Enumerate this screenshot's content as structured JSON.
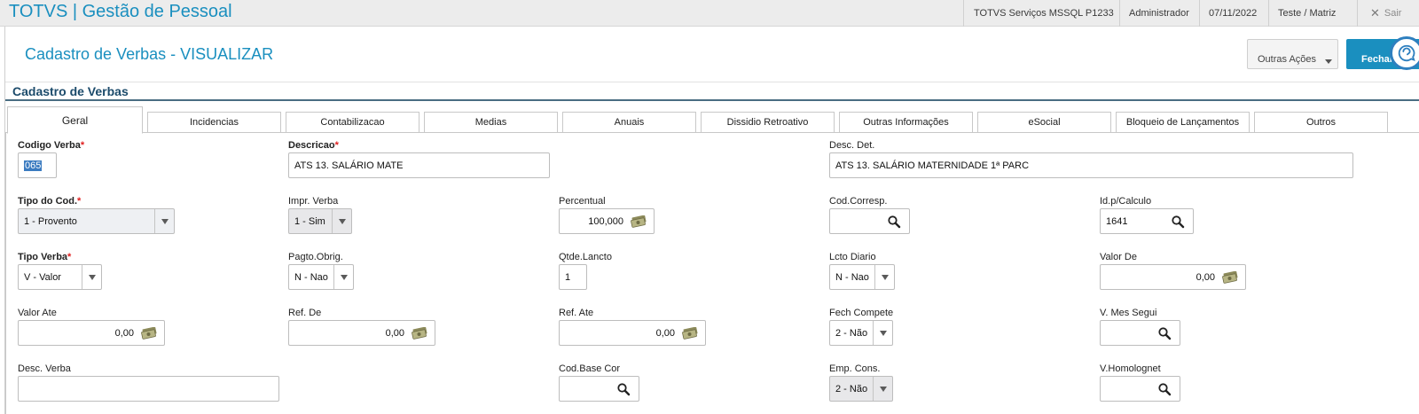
{
  "app": {
    "title": "TOTVS | Gestão de Pessoal"
  },
  "topbar": {
    "server": "TOTVS Serviços MSSQL P1233",
    "user": "Administrador",
    "date": "07/11/2022",
    "branch": "Teste / Matriz",
    "logout": "Sair"
  },
  "header": {
    "title": "Cadastro de Verbas - VISUALIZAR",
    "other_actions": "Outras Ações",
    "close": "Fechar"
  },
  "section": {
    "title": "Cadastro de Verbas"
  },
  "tabs": [
    {
      "label": "Geral",
      "active": true
    },
    {
      "label": "Incidencias"
    },
    {
      "label": "Contabilizacao"
    },
    {
      "label": "Medias"
    },
    {
      "label": "Anuais"
    },
    {
      "label": "Dissidio Retroativo"
    },
    {
      "label": "Outras Informações"
    },
    {
      "label": "eSocial"
    },
    {
      "label": "Bloqueio de Lançamentos"
    },
    {
      "label": "Outros"
    }
  ],
  "fields": {
    "codigo_verba": {
      "label": "Codigo Verba",
      "value": "065"
    },
    "descricao": {
      "label": "Descricao",
      "value": "ATS 13. SALÁRIO MATE"
    },
    "desc_det": {
      "label": "Desc. Det.",
      "value": "ATS 13. SALÁRIO MATERNIDADE 1ª PARC"
    },
    "tipo_cod": {
      "label": "Tipo do Cod.",
      "value": "1 - Provento"
    },
    "impr_verba": {
      "label": "Impr. Verba",
      "value": "1 - Sim"
    },
    "percentual": {
      "label": "Percentual",
      "value": "100,000"
    },
    "cod_corresp": {
      "label": "Cod.Corresp.",
      "value": ""
    },
    "id_calculo": {
      "label": "Id.p/Calculo",
      "value": "1641"
    },
    "tipo_verba": {
      "label": "Tipo Verba",
      "value": "V - Valor"
    },
    "pagto_obrig": {
      "label": "Pagto.Obrig.",
      "value": "N - Nao"
    },
    "qtde_lancto": {
      "label": "Qtde.Lancto",
      "value": "1"
    },
    "lcto_diario": {
      "label": "Lcto Diario",
      "value": "N - Nao"
    },
    "valor_de": {
      "label": "Valor De",
      "value": "0,00"
    },
    "valor_ate": {
      "label": "Valor Ate",
      "value": "0,00"
    },
    "ref_de": {
      "label": "Ref. De",
      "value": "0,00"
    },
    "ref_ate": {
      "label": "Ref. Ate",
      "value": "0,00"
    },
    "fech_compete": {
      "label": "Fech Compete",
      "value": "2 - Não"
    },
    "v_mes_segui": {
      "label": "V. Mes Segui",
      "value": ""
    },
    "desc_verba": {
      "label": "Desc. Verba",
      "value": ""
    },
    "cod_base_cor": {
      "label": "Cod.Base Cor",
      "value": ""
    },
    "emp_cons": {
      "label": "Emp. Cons.",
      "value": "2 - Não"
    },
    "v_homolognet": {
      "label": "V.Homolognet",
      "value": ""
    }
  },
  "required_marker": "*",
  "icons": {
    "search": "magnifier-icon",
    "money": "money-bills-icon",
    "close": "x-icon",
    "chat": "chat-assistant-icon"
  },
  "colors": {
    "accent": "#1a8fbf",
    "section_title": "#1c4b6b",
    "required": "#e02020"
  }
}
